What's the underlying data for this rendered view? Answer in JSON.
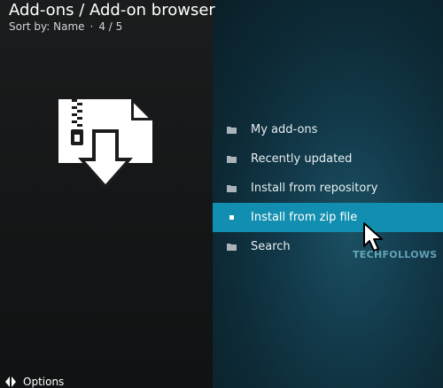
{
  "header": {
    "title": "Add-ons / Add-on browser",
    "sort_label": "Sort by: Name",
    "separator": "·",
    "position": "4 / 5"
  },
  "addon_icon": "zip-file-download-icon",
  "menu": {
    "items": [
      {
        "label": "My add-ons",
        "icon": "folder-icon"
      },
      {
        "label": "Recently updated",
        "icon": "folder-icon"
      },
      {
        "label": "Install from repository",
        "icon": "folder-icon"
      },
      {
        "label": "Install from zip file",
        "icon": "folder-icon",
        "selected": true
      },
      {
        "label": "Search",
        "icon": "folder-icon"
      }
    ]
  },
  "watermark": "TECHFOLLOWS",
  "footer": {
    "options_label": "Options",
    "icon": "options-arrows-icon"
  },
  "colors": {
    "selected_bg": "#128fb0",
    "left_bg": "#161819",
    "right_bg": "#12394a"
  }
}
